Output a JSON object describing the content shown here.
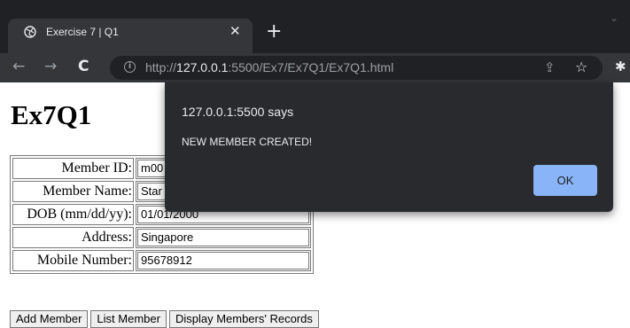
{
  "browser": {
    "tab_title": "Exercise 7 | Q1",
    "new_tab_glyph": "+",
    "url_scheme": "http://",
    "url_host": "127.0.0.1",
    "url_path": ":5500/Ex7/Ex7Q1/Ex7Q1.html",
    "icons": [
      "globe-icon",
      "close-icon",
      "plus-icon",
      "back-icon",
      "forward-icon",
      "reload-icon",
      "info-icon",
      "share-icon",
      "star-icon",
      "extensions-icon"
    ]
  },
  "page": {
    "title": "Ex7Q1",
    "form": {
      "rows": [
        {
          "label": "Member ID:",
          "value": "m00"
        },
        {
          "label": "Member Name:",
          "value": "Star"
        },
        {
          "label": "DOB (mm/dd/yy):",
          "value": "01/01/2000"
        },
        {
          "label": "Address:",
          "value": "Singapore"
        },
        {
          "label": "Mobile Number:",
          "value": "95678912"
        }
      ]
    },
    "buttons": {
      "add": "Add Member",
      "list": "List Member",
      "display": "Display Members' Records"
    }
  },
  "dialog": {
    "origin": "127.0.0.1:5500 says",
    "message": "NEW MEMBER CREATED!",
    "ok_label": "OK"
  },
  "colors": {
    "chrome_dark": "#202124",
    "toolbar": "#35363a",
    "dialog_bg": "#292a2d",
    "ok_button": "#8ab4f8"
  }
}
